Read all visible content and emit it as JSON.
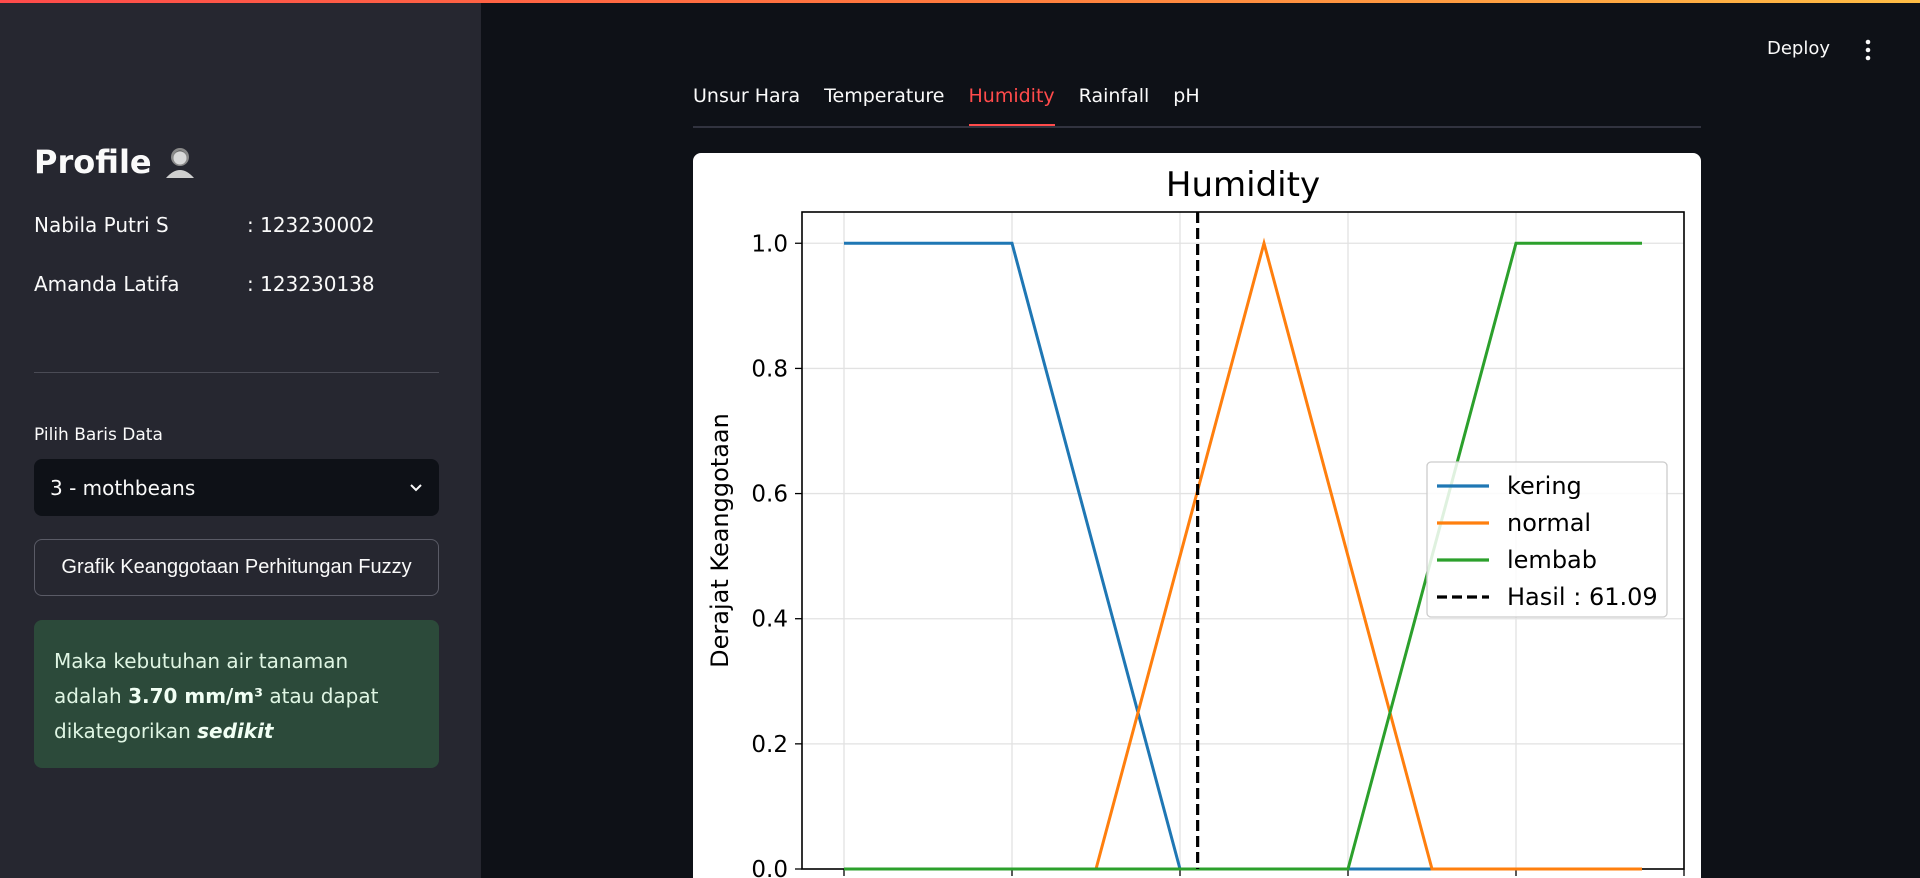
{
  "header": {
    "deploy_label": "Deploy"
  },
  "sidebar": {
    "profile_title": "Profile",
    "members": [
      {
        "name": "Nabila Putri S",
        "id": ": 123230002"
      },
      {
        "name": "Amanda Latifa",
        "id": ": 123230138"
      }
    ],
    "select_label": "Pilih Baris Data",
    "select_value": "3 - mothbeans",
    "button_label": "Grafik Keanggotaan Perhitungan Fuzzy",
    "result": {
      "prefix": "Maka kebutuhan air tanaman adalah",
      "value": "3.70 mm/m³",
      "middle": "atau dapat dikategorikan",
      "category": "sedikit"
    }
  },
  "tabs": [
    {
      "label": "Unsur Hara",
      "active": false
    },
    {
      "label": "Temperature",
      "active": false
    },
    {
      "label": "Humidity",
      "active": true
    },
    {
      "label": "Rainfall",
      "active": false
    },
    {
      "label": "pH",
      "active": false
    }
  ],
  "chart_data": {
    "type": "line",
    "title": "Humidity",
    "ylabel": "Derajat Keanggotaan",
    "xlabel": "",
    "ylim": [
      0,
      1.05
    ],
    "xlim": [
      0,
      105
    ],
    "yticks": [
      "0.0",
      "0.2",
      "0.4",
      "0.6",
      "0.8",
      "1.0"
    ],
    "grid": true,
    "legend_position": "center-right",
    "series": [
      {
        "name": "kering",
        "color": "#1f77b4",
        "x": [
          5,
          25,
          45,
          65,
          85,
          100
        ],
        "y": [
          1,
          1,
          0,
          0,
          0,
          0
        ]
      },
      {
        "name": "normal",
        "color": "#ff7f0e",
        "x": [
          5,
          35,
          55,
          75,
          85,
          100
        ],
        "y": [
          0,
          0,
          1,
          0,
          0,
          0
        ]
      },
      {
        "name": "lembab",
        "color": "#2ca02c",
        "x": [
          5,
          45,
          65,
          85,
          100
        ],
        "y": [
          0,
          0,
          0,
          1,
          1
        ]
      }
    ],
    "vline": {
      "name": "Hasil : 61.09",
      "x": 47.1,
      "color": "#000000",
      "style": "dashed"
    },
    "xticks_at": [
      5,
      25,
      45,
      65,
      85,
      105
    ]
  }
}
